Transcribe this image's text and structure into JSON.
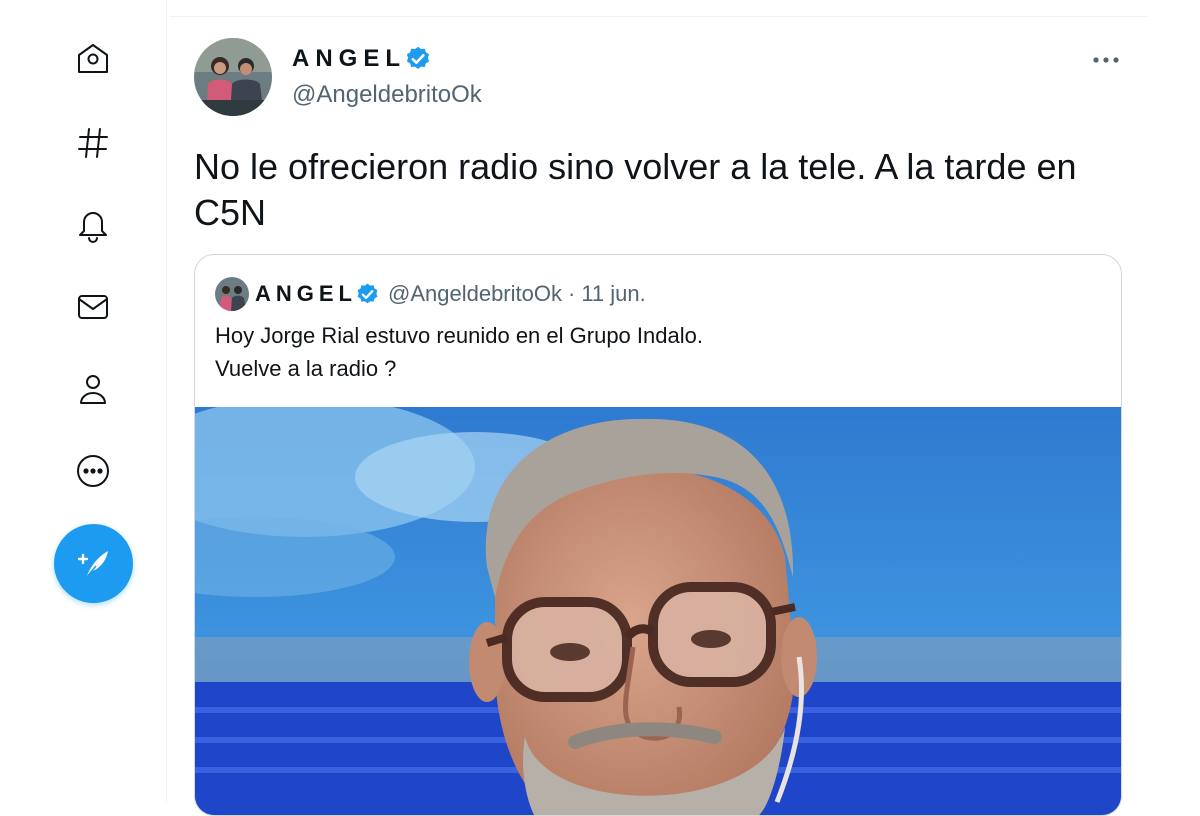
{
  "nav": {
    "items": [
      {
        "id": "home",
        "icon": "home-icon"
      },
      {
        "id": "explore",
        "icon": "hashtag-icon"
      },
      {
        "id": "notifications",
        "icon": "bell-icon"
      },
      {
        "id": "messages",
        "icon": "envelope-icon"
      },
      {
        "id": "profile",
        "icon": "user-icon"
      },
      {
        "id": "more",
        "icon": "more-circle-icon"
      }
    ],
    "compose_icon": "compose-tweet-icon"
  },
  "tweet": {
    "display_name": "ANGEL",
    "handle": "@AngeldebritoOk",
    "text_line1": "No le ofrecieron radio sino volver a la tele. A la tarde en",
    "text_line2": "C5N",
    "more_icon": "ellipsis-icon"
  },
  "quote": {
    "display_name": "ANGEL",
    "handle": "@AngeldebritoOk",
    "separator": "·",
    "date": "11 jun.",
    "text_line1": "Hoy Jorge Rial estuvo reunido en el Grupo Indalo.",
    "text_line2": "Vuelve a la radio ?"
  },
  "colors": {
    "accent": "#1d9bf0",
    "text": "#0f1419",
    "secondary": "#536471",
    "border": "#cfd9de"
  }
}
